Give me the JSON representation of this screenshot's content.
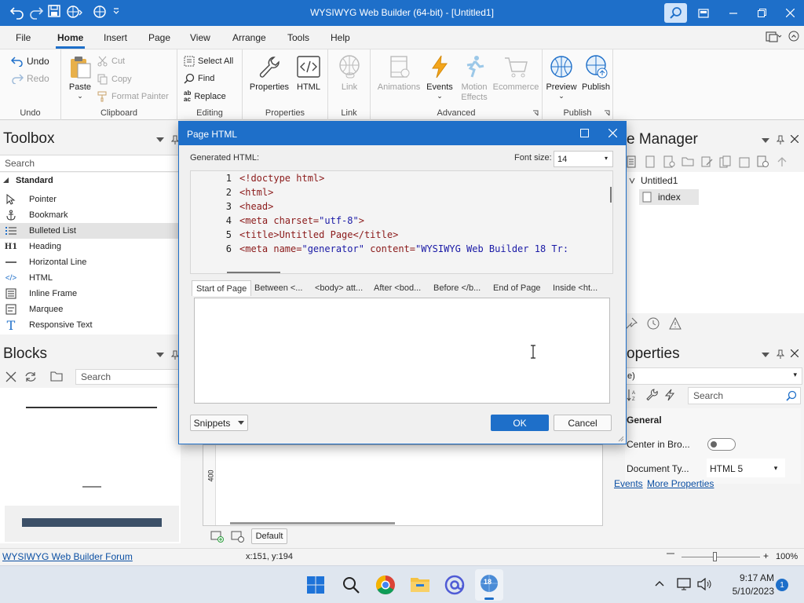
{
  "titlebar": {
    "title": "WYSIWYG Web Builder (64-bit) - [Untitled1]",
    "accent": "#1e6fc9"
  },
  "menu": [
    "File",
    "Home",
    "Insert",
    "Page",
    "View",
    "Arrange",
    "Tools",
    "Help"
  ],
  "ribbon": {
    "undo": {
      "undo": "Undo",
      "redo": "Redo",
      "group": "Undo"
    },
    "clipboard": {
      "paste": "Paste",
      "cut": "Cut",
      "copy": "Copy",
      "format_painter": "Format Painter",
      "group": "Clipboard"
    },
    "editing": {
      "select_all": "Select All",
      "find": "Find",
      "replace": "Replace",
      "group": "Editing"
    },
    "properties": {
      "properties": "Properties",
      "html": "HTML",
      "group": "Properties"
    },
    "link": {
      "link": "Link",
      "group": "Link"
    },
    "advanced": {
      "animations": "Animations",
      "events": "Events",
      "motion": "Motion Effects",
      "motion1": "Motion",
      "motion2": "Effects",
      "ecommerce": "Ecommerce",
      "group": "Advanced"
    },
    "publish": {
      "preview": "Preview",
      "publish": "Publish",
      "group": "Publish"
    }
  },
  "toolbox": {
    "title": "Toolbox",
    "search_placeholder": "Search",
    "section": "Standard",
    "items": [
      {
        "label": "Pointer",
        "icon": "pointer-icon"
      },
      {
        "label": "Bookmark",
        "icon": "anchor-icon"
      },
      {
        "label": "Bulleted List",
        "icon": "list-icon",
        "selected": true
      },
      {
        "label": "Heading",
        "icon": "heading-icon",
        "glyph": "H1"
      },
      {
        "label": "Horizontal Line",
        "icon": "hline-icon"
      },
      {
        "label": "HTML",
        "icon": "code-icon",
        "glyph": "</>"
      },
      {
        "label": "Inline Frame",
        "icon": "iframe-icon"
      },
      {
        "label": "Marquee",
        "icon": "marquee-icon"
      },
      {
        "label": "Responsive Text",
        "icon": "text-icon",
        "glyph": "T"
      }
    ]
  },
  "blocks": {
    "title": "Blocks",
    "search_placeholder": "Search"
  },
  "site_manager": {
    "title": "e Manager",
    "root": "Untitled1",
    "page": "index"
  },
  "properties_panel": {
    "title": "operties",
    "selector": "e)",
    "search_placeholder": "Search",
    "section": "General",
    "center_label": "Center in Bro...",
    "doctype_label": "Document Ty...",
    "doctype_value": "HTML 5",
    "events_link": "Events",
    "more_link": "More Properties"
  },
  "dialog": {
    "title": "Page HTML",
    "generated_label": "Generated HTML:",
    "font_size_label": "Font size:",
    "font_size_value": "14",
    "code": [
      {
        "n": "1",
        "t": "<!doctype html>"
      },
      {
        "n": "2",
        "t": "<html>"
      },
      {
        "n": "3",
        "t": "<head>"
      },
      {
        "n": "4",
        "a": "<meta charset=",
        "b": "\"utf-8\"",
        "c": ">"
      },
      {
        "n": "5",
        "t": "<title>Untitled Page</title>"
      },
      {
        "n": "6",
        "a": "<meta name=",
        "b": "\"generator\"",
        "c": " content=",
        "d": "\"WYSIWYG Web Builder 18 Tr:"
      }
    ],
    "tabs": [
      "Start of Page",
      "Between <...",
      "<body> att...",
      "After <bod...",
      "Before </b...",
      "End of Page",
      "Inside <ht..."
    ],
    "snippets": "Snippets",
    "ok": "OK",
    "cancel": "Cancel"
  },
  "canvas": {
    "ruler_label": "400",
    "default_label": "Default"
  },
  "status": {
    "forum_link": "WYSIWYG Web Builder Forum",
    "coords": "x:151, y:194",
    "zoom": "100%"
  },
  "taskbar": {
    "time": "9:17 AM",
    "date": "5/10/2023",
    "badge": "1",
    "app_badge": "18"
  }
}
